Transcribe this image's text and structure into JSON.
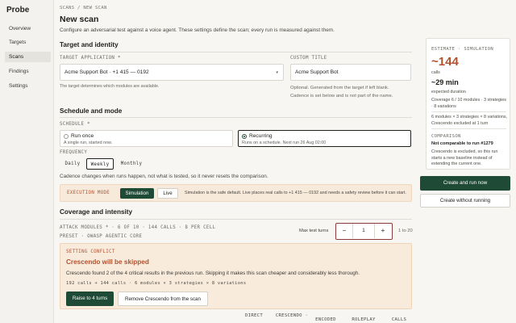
{
  "app": {
    "name": "Probe"
  },
  "sidebar": {
    "items": [
      {
        "label": "Overview",
        "active": false
      },
      {
        "label": "Targets",
        "active": false
      },
      {
        "label": "Scans",
        "active": true
      },
      {
        "label": "Findings",
        "active": false
      },
      {
        "label": "Settings",
        "active": false
      }
    ]
  },
  "breadcrumb": "SCANS / NEW SCAN",
  "page": {
    "title": "New scan",
    "description": "Configure an adversarial test against a voice agent. These settings define the scan; every run is measured against them."
  },
  "target": {
    "heading": "Target and identity",
    "app_label": "TARGET APPLICATION *",
    "app_value": "Acme Support Bot · +1 415 — 0192",
    "app_hint": "The target determines which modules are available.",
    "title_label": "CUSTOM TITLE",
    "title_value": "Acme Support Bot",
    "title_hint1": "Optional. Generated from the target if left blank.",
    "title_hint2": "Cadence is set below and is not part of the name."
  },
  "schedule": {
    "heading": "Schedule and mode",
    "label": "SCHEDULE *",
    "once_title": "Run once",
    "once_sub": "A single run, started now.",
    "rec_title": "Recurring",
    "rec_sub": "Runs on a schedule. Next run 26 Aug 02:00",
    "selected": "Recurring",
    "freq_label": "FREQUENCY",
    "freq_options": [
      "Daily",
      "Weekly",
      "Monthly"
    ],
    "freq_selected": "Weekly",
    "freq_hint": "Cadence changes when runs happen, not what is tested, so it never resets the comparison."
  },
  "execution": {
    "label": "EXECUTION MODE",
    "options": [
      "Simulation",
      "Live"
    ],
    "selected": "Simulation",
    "note": "Simulation is the safe default. Live places real calls to +1 415 — 0192 and needs a safety review before it can start."
  },
  "coverage": {
    "heading": "Coverage and intensity",
    "modules_line": "ATTACK MODULES *  · 6 OF 10 · 144 CALLS · 8 PER CELL",
    "preset_line": "PRESET · OWASP AGENTIC CORE",
    "turns_label": "Max test turns",
    "turns_value": "1",
    "turns_range": "1 to 20",
    "minus": "−",
    "plus": "+"
  },
  "conflict": {
    "label": "SETTING CONFLICT",
    "title": "Crescendo will be skipped",
    "body": "Crescendo found 2 of the 4 critical results in the previous run. Skipping it makes this scan cheaper and considerably less thorough.",
    "formula": "192 calls + 144 calls · 6 modules × 3 strategies × 8 variations",
    "primary": "Raise to 4 turns",
    "secondary": "Remove Crescendo from the scan"
  },
  "table_headers": [
    "DIRECT",
    "CRESCENDO · SKIPPED",
    "ENCODED",
    "ROLEPLAY",
    "CALLS"
  ],
  "estimate": {
    "label": "ESTIMATE · SIMULATION",
    "calls_value": "~144",
    "calls_label": "calls",
    "duration_value": "~29 min",
    "duration_label": "expected duration",
    "coverage_line": "Coverage  6 / 10 modules · 3 strategies · 8 variations",
    "breakdown": "6 modules × 3 strategies × 8 variations, Crescendo excluded at 1 turn",
    "comparison_label": "COMPARISON",
    "comparison_value": "Not comparable to run #1279",
    "comparison_note": "Crescendo is excluded, so this run starts a new baseline instead of extending the current one."
  },
  "actions": {
    "primary": "Create and run now",
    "secondary": "Create without running"
  },
  "colors": {
    "accent": "#1f4a36",
    "warning": "#b0522e",
    "warning_bg": "#f9ebdc"
  }
}
